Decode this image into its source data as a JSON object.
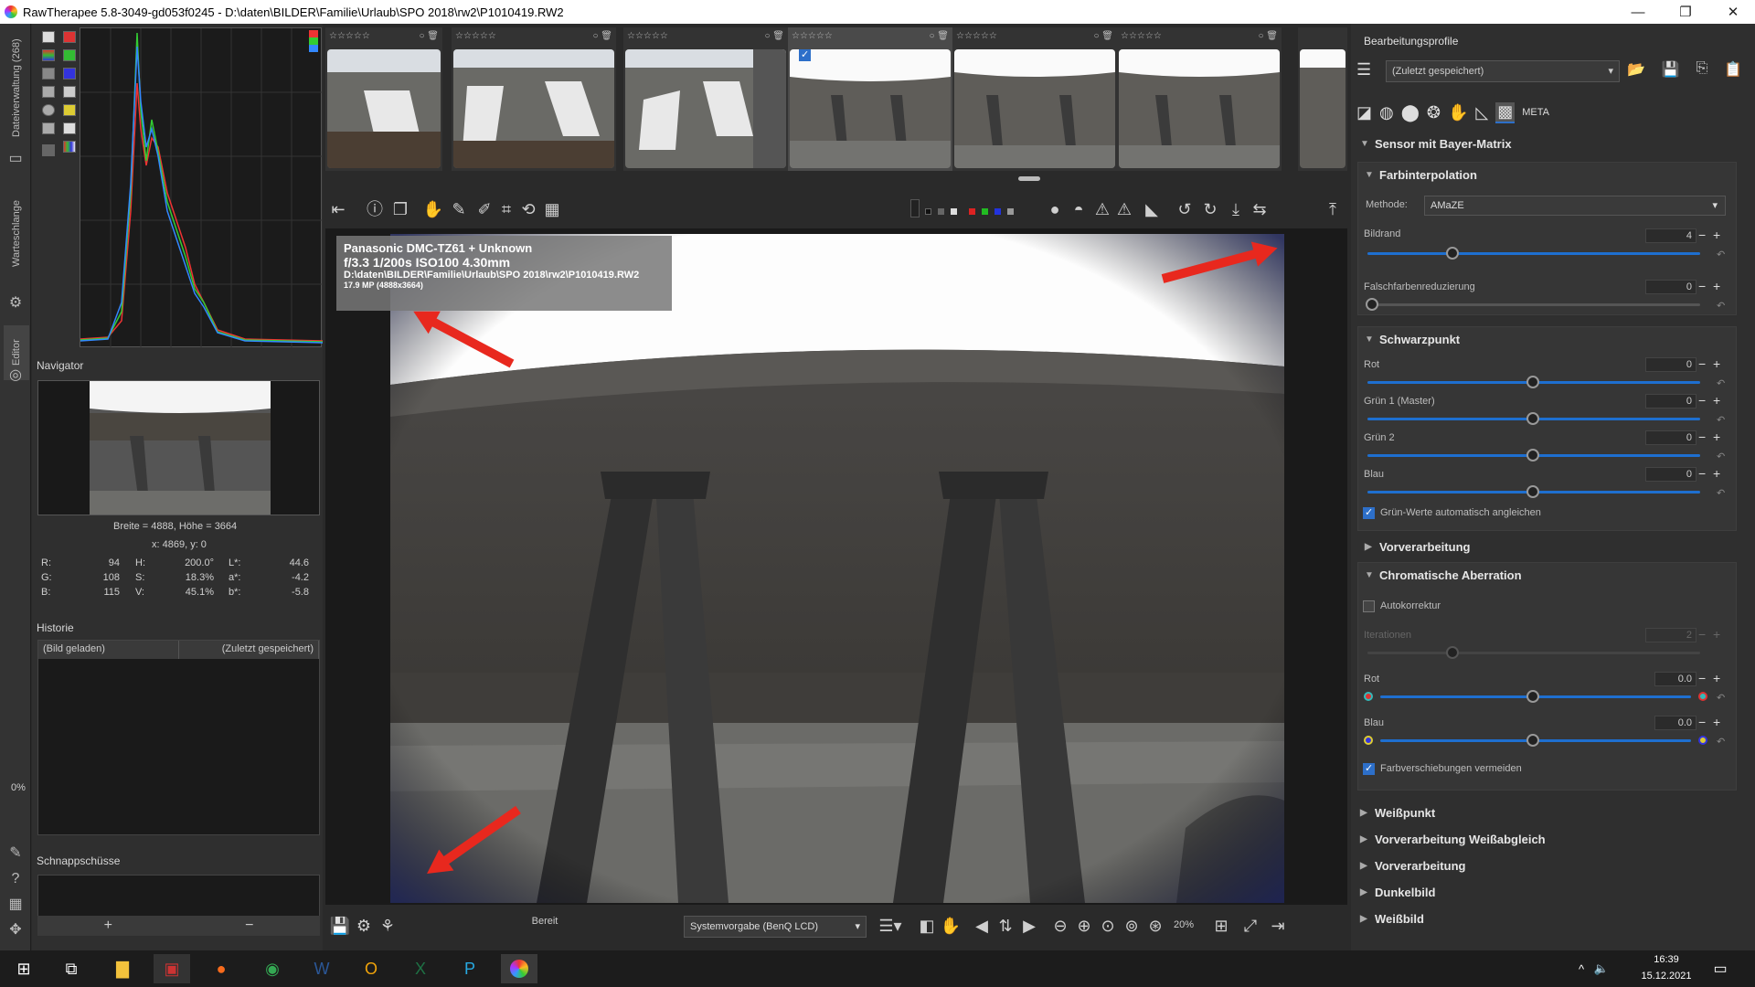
{
  "window": {
    "title": "RawTherapee 5.8-3049-gd053f0245 - D:\\daten\\BILDER\\Familie\\Urlaub\\SPO 2018\\rw2\\P1010419.RW2",
    "minimize": "—",
    "maximize": "❐",
    "close": "✕"
  },
  "left_tabs": {
    "file_browser": "Dateiverwaltung (268)",
    "queue": "Warteschlange",
    "editor": "Editor"
  },
  "navigator": {
    "title": "Navigator",
    "size_text": "Breite = 4888, Höhe = 3664",
    "coords": "x: 4869, y: 0",
    "values": [
      {
        "label": "R:",
        "value": "94",
        "label2": "H:",
        "value2": "200.0°",
        "label3": "L*:",
        "value3": "44.6"
      },
      {
        "label": "G:",
        "value": "108",
        "label2": "S:",
        "value2": "18.3%",
        "label3": "a*:",
        "value3": "-4.2"
      },
      {
        "label": "B:",
        "value": "115",
        "label2": "V:",
        "value2": "45.1%",
        "label3": "b*:",
        "value3": "-5.8"
      }
    ]
  },
  "history": {
    "title": "Historie",
    "col1": "(Bild geladen)",
    "col2": "(Zuletzt gespeichert)"
  },
  "snapshots": {
    "title": "Schnappschüsse",
    "add": "+",
    "remove": "−"
  },
  "progress": "0%",
  "filmstrip": {
    "stars": "☆☆☆☆☆",
    "thumbs": 6
  },
  "image_info": {
    "line1": "Panasonic DMC-TZ61 + Unknown",
    "line2": "f/3.3  1/200s  ISO100  4.30mm",
    "line3": "D:\\daten\\BILDER\\Familie\\Urlaub\\SPO 2018\\rw2\\P1010419.RW2",
    "line4": "17.9 MP (4888x3664)"
  },
  "bottom": {
    "status": "Bereit",
    "profile": "Systemvorgabe (BenQ LCD)",
    "zoom": "20%"
  },
  "right": {
    "profiles_title": "Bearbeitungsprofile",
    "profile_value": "(Zuletzt gespeichert)",
    "sensor_title": "Sensor mit Bayer-Matrix",
    "demosaic": {
      "title": "Farbinterpolation",
      "method_label": "Methode:",
      "method_value": "AMaZE",
      "border_label": "Bildrand",
      "border_value": "4",
      "fcs_label": "Falschfarbenreduzierung",
      "fcs_value": "0"
    },
    "blackpoint": {
      "title": "Schwarzpunkt",
      "red_label": "Rot",
      "red_value": "0",
      "green1_label": "Grün 1 (Master)",
      "green1_value": "0",
      "green2_label": "Grün 2",
      "green2_value": "0",
      "blue_label": "Blau",
      "blue_value": "0",
      "auto_label": "Grün-Werte automatisch angleichen"
    },
    "preprocessing": "Vorverarbeitung",
    "ca": {
      "title": "Chromatische Aberration",
      "auto_label": "Autokorrektur",
      "iter_label": "Iterationen",
      "iter_value": "2",
      "red_label": "Rot",
      "red_value": "0.0",
      "blue_label": "Blau",
      "blue_value": "0.0",
      "avoid_label": "Farbverschiebungen vermeiden"
    },
    "more_sections": [
      "Weißpunkt",
      "Vorverarbeitung Weißabgleich",
      "Vorverarbeitung",
      "Dunkelbild",
      "Weißbild"
    ]
  },
  "taskbar": {
    "time": "16:39",
    "date": "15.12.2021"
  }
}
